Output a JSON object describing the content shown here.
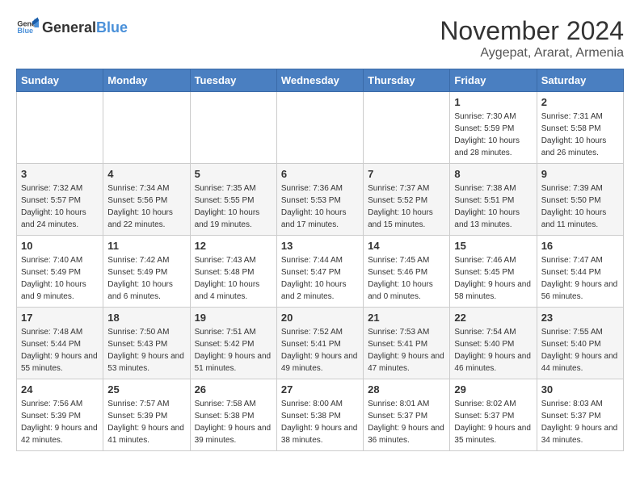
{
  "logo": {
    "general": "General",
    "blue": "Blue"
  },
  "title": {
    "month": "November 2024",
    "location": "Aygepat, Ararat, Armenia"
  },
  "headers": [
    "Sunday",
    "Monday",
    "Tuesday",
    "Wednesday",
    "Thursday",
    "Friday",
    "Saturday"
  ],
  "weeks": [
    [
      {
        "day": "",
        "info": ""
      },
      {
        "day": "",
        "info": ""
      },
      {
        "day": "",
        "info": ""
      },
      {
        "day": "",
        "info": ""
      },
      {
        "day": "",
        "info": ""
      },
      {
        "day": "1",
        "info": "Sunrise: 7:30 AM\nSunset: 5:59 PM\nDaylight: 10 hours and 28 minutes."
      },
      {
        "day": "2",
        "info": "Sunrise: 7:31 AM\nSunset: 5:58 PM\nDaylight: 10 hours and 26 minutes."
      }
    ],
    [
      {
        "day": "3",
        "info": "Sunrise: 7:32 AM\nSunset: 5:57 PM\nDaylight: 10 hours and 24 minutes."
      },
      {
        "day": "4",
        "info": "Sunrise: 7:34 AM\nSunset: 5:56 PM\nDaylight: 10 hours and 22 minutes."
      },
      {
        "day": "5",
        "info": "Sunrise: 7:35 AM\nSunset: 5:55 PM\nDaylight: 10 hours and 19 minutes."
      },
      {
        "day": "6",
        "info": "Sunrise: 7:36 AM\nSunset: 5:53 PM\nDaylight: 10 hours and 17 minutes."
      },
      {
        "day": "7",
        "info": "Sunrise: 7:37 AM\nSunset: 5:52 PM\nDaylight: 10 hours and 15 minutes."
      },
      {
        "day": "8",
        "info": "Sunrise: 7:38 AM\nSunset: 5:51 PM\nDaylight: 10 hours and 13 minutes."
      },
      {
        "day": "9",
        "info": "Sunrise: 7:39 AM\nSunset: 5:50 PM\nDaylight: 10 hours and 11 minutes."
      }
    ],
    [
      {
        "day": "10",
        "info": "Sunrise: 7:40 AM\nSunset: 5:49 PM\nDaylight: 10 hours and 9 minutes."
      },
      {
        "day": "11",
        "info": "Sunrise: 7:42 AM\nSunset: 5:49 PM\nDaylight: 10 hours and 6 minutes."
      },
      {
        "day": "12",
        "info": "Sunrise: 7:43 AM\nSunset: 5:48 PM\nDaylight: 10 hours and 4 minutes."
      },
      {
        "day": "13",
        "info": "Sunrise: 7:44 AM\nSunset: 5:47 PM\nDaylight: 10 hours and 2 minutes."
      },
      {
        "day": "14",
        "info": "Sunrise: 7:45 AM\nSunset: 5:46 PM\nDaylight: 10 hours and 0 minutes."
      },
      {
        "day": "15",
        "info": "Sunrise: 7:46 AM\nSunset: 5:45 PM\nDaylight: 9 hours and 58 minutes."
      },
      {
        "day": "16",
        "info": "Sunrise: 7:47 AM\nSunset: 5:44 PM\nDaylight: 9 hours and 56 minutes."
      }
    ],
    [
      {
        "day": "17",
        "info": "Sunrise: 7:48 AM\nSunset: 5:44 PM\nDaylight: 9 hours and 55 minutes."
      },
      {
        "day": "18",
        "info": "Sunrise: 7:50 AM\nSunset: 5:43 PM\nDaylight: 9 hours and 53 minutes."
      },
      {
        "day": "19",
        "info": "Sunrise: 7:51 AM\nSunset: 5:42 PM\nDaylight: 9 hours and 51 minutes."
      },
      {
        "day": "20",
        "info": "Sunrise: 7:52 AM\nSunset: 5:41 PM\nDaylight: 9 hours and 49 minutes."
      },
      {
        "day": "21",
        "info": "Sunrise: 7:53 AM\nSunset: 5:41 PM\nDaylight: 9 hours and 47 minutes."
      },
      {
        "day": "22",
        "info": "Sunrise: 7:54 AM\nSunset: 5:40 PM\nDaylight: 9 hours and 46 minutes."
      },
      {
        "day": "23",
        "info": "Sunrise: 7:55 AM\nSunset: 5:40 PM\nDaylight: 9 hours and 44 minutes."
      }
    ],
    [
      {
        "day": "24",
        "info": "Sunrise: 7:56 AM\nSunset: 5:39 PM\nDaylight: 9 hours and 42 minutes."
      },
      {
        "day": "25",
        "info": "Sunrise: 7:57 AM\nSunset: 5:39 PM\nDaylight: 9 hours and 41 minutes."
      },
      {
        "day": "26",
        "info": "Sunrise: 7:58 AM\nSunset: 5:38 PM\nDaylight: 9 hours and 39 minutes."
      },
      {
        "day": "27",
        "info": "Sunrise: 8:00 AM\nSunset: 5:38 PM\nDaylight: 9 hours and 38 minutes."
      },
      {
        "day": "28",
        "info": "Sunrise: 8:01 AM\nSunset: 5:37 PM\nDaylight: 9 hours and 36 minutes."
      },
      {
        "day": "29",
        "info": "Sunrise: 8:02 AM\nSunset: 5:37 PM\nDaylight: 9 hours and 35 minutes."
      },
      {
        "day": "30",
        "info": "Sunrise: 8:03 AM\nSunset: 5:37 PM\nDaylight: 9 hours and 34 minutes."
      }
    ]
  ]
}
